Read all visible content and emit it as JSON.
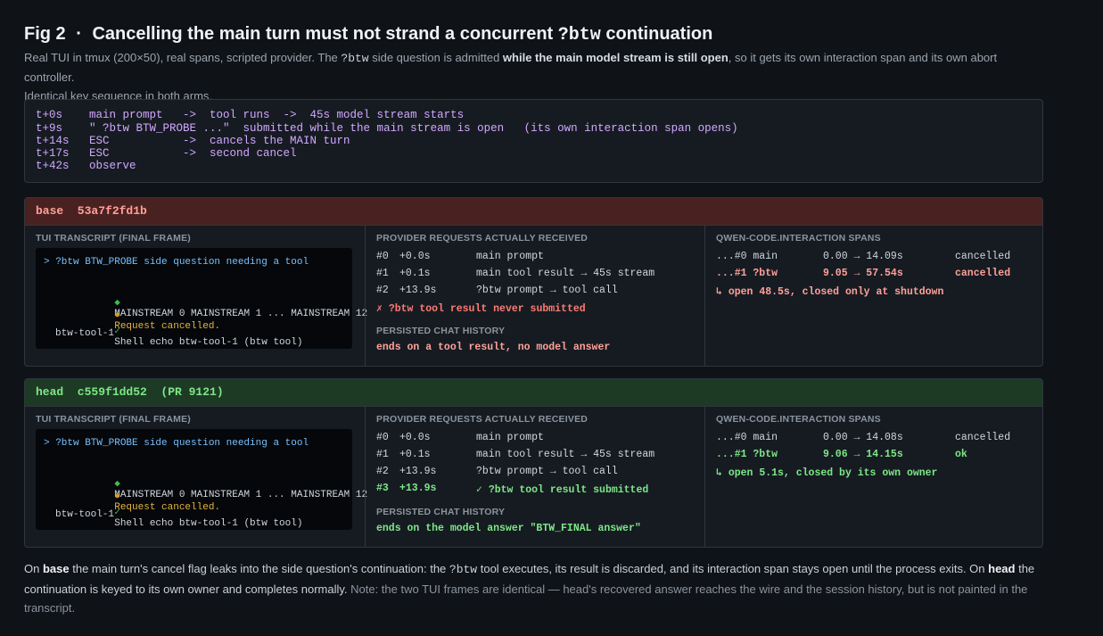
{
  "figure": {
    "fig_label": "Fig 2",
    "dot": "·",
    "title_pre": "Cancelling the main turn must not strand a concurrent",
    "title_code": "?btw",
    "title_post": "continuation"
  },
  "subtitle": {
    "p1": "Real TUI in tmux (200×50), real spans, scripted provider. The ",
    "code": "?btw",
    "p2": " side question is admitted ",
    "bold": "while the main model stream is still open",
    "p3": ", so it gets its own interaction span and its own abort controller.",
    "line2": "Identical key sequence in both arms."
  },
  "timeline": [
    "t+0s    main prompt   ->  tool runs  ->  45s model stream starts",
    "t+9s    \" ?btw BTW_PROBE ...\"  submitted while the main stream is open   (its own interaction span opens)",
    "t+14s   ESC           ->  cancels the MAIN turn",
    "t+17s   ESC           ->  second cancel",
    "t+42s   observe"
  ],
  "labels": {
    "transcript": "TUI TRANSCRIPT (FINAL FRAME)",
    "provider": "PROVIDER REQUESTS ACTUALLY RECEIVED",
    "history": "PERSISTED CHAT HISTORY",
    "spans": "QWEN-CODE.INTERACTION SPANS"
  },
  "base": {
    "header": "base  53a7f2fd1b",
    "transcript": {
      "prompt": "> ?btw BTW_PROBE side question needing a tool",
      "mainstream_icon": "◆",
      "mainstream": "MAINSTREAM 0 MAINSTREAM 1 ... MAINSTREAM 12",
      "cancel_icon": "●",
      "cancel": "Request cancelled.",
      "shell_icon": "✓",
      "shell": "Shell echo btw-tool-1 (btw tool)",
      "output": "btw-tool-1"
    },
    "requests": [
      {
        "id": "#0",
        "t": "+0.0s",
        "desc": "main prompt"
      },
      {
        "id": "#1",
        "t": "+0.1s",
        "desc": "main tool result → 45s stream"
      },
      {
        "id": "#2",
        "t": "+13.9s",
        "desc": "?btw prompt → tool call"
      }
    ],
    "request_note": "✗ ?btw tool result never submitted",
    "history": "ends on a tool result, no model answer",
    "spans": [
      {
        "name": "...#0 main",
        "range": "0.00 → 14.09s",
        "status": "cancelled"
      },
      {
        "name": "...#1 ?btw",
        "range": "9.05 → 57.54s",
        "status": "cancelled"
      }
    ],
    "span_note": "↳ open 48.5s, closed only at shutdown"
  },
  "head": {
    "header": "head  c559f1dd52  (PR 9121)",
    "transcript": {
      "prompt": "> ?btw BTW_PROBE side question needing a tool",
      "mainstream_icon": "◆",
      "mainstream": "MAINSTREAM 0 MAINSTREAM 1 ... MAINSTREAM 12",
      "cancel_icon": "●",
      "cancel": "Request cancelled.",
      "shell_icon": "✓",
      "shell": "Shell echo btw-tool-1 (btw tool)",
      "output": "btw-tool-1"
    },
    "requests": [
      {
        "id": "#0",
        "t": "+0.0s",
        "desc": "main prompt"
      },
      {
        "id": "#1",
        "t": "+0.1s",
        "desc": "main tool result → 45s stream"
      },
      {
        "id": "#2",
        "t": "+13.9s",
        "desc": "?btw prompt → tool call"
      },
      {
        "id": "#3",
        "t": "+13.9s",
        "desc": "✓ ?btw tool result submitted"
      }
    ],
    "history": "ends on the model answer \"BTW_FINAL answer\"",
    "spans": [
      {
        "name": "...#0 main",
        "range": "0.00 → 14.08s",
        "status": "cancelled"
      },
      {
        "name": "...#1 ?btw",
        "range": "9.06 → 14.15s",
        "status": "ok"
      }
    ],
    "span_note": "↳ open 5.1s, closed by its own owner"
  },
  "footer": {
    "a1": "On ",
    "a_base": "base",
    "a2": " the main turn's cancel flag leaks into the side question's continuation: the ",
    "a_code": "?btw",
    "a3": " tool executes, its result is discarded, and its interaction span stays open until the process exits. On ",
    "a_head": "head",
    "a4": " the continuation is keyed to its own owner and completes normally.",
    "note": " Note: the two TUI frames are identical — head's recovered answer reaches the wire and the session history, but is not painted in the transcript."
  },
  "colors": {
    "background": "#0f1217",
    "base_header": "#4a2121",
    "head_header": "#1d3a24",
    "timeline_text": "#d2a8ff",
    "fail": "#ff7b72",
    "ok": "#7ee787"
  }
}
